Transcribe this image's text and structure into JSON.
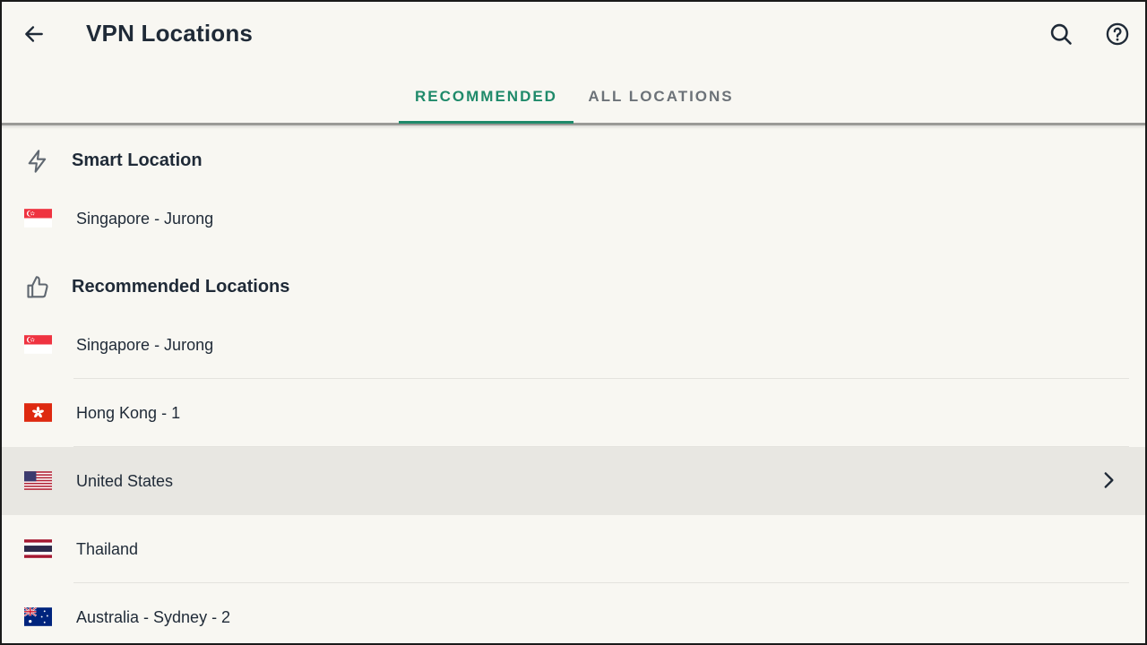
{
  "header": {
    "title": "VPN Locations",
    "back_icon": "arrow-left-icon",
    "search_icon": "search-icon",
    "help_icon": "help-circle-icon"
  },
  "tabs": [
    {
      "label": "RECOMMENDED",
      "active": true
    },
    {
      "label": "ALL LOCATIONS",
      "active": false
    }
  ],
  "colors": {
    "accent": "#1f8a6a",
    "background": "#f8f7f2",
    "selected_row": "#e8e7e2",
    "text": "#1f2a37",
    "inactive_tab": "#6c7278"
  },
  "smart_section": {
    "title": "Smart Location",
    "icon": "lightning-icon",
    "items": [
      {
        "label": "Singapore - Jurong",
        "flag": "singapore-flag-icon"
      }
    ]
  },
  "recommended_section": {
    "title": "Recommended Locations",
    "icon": "thumbs-up-icon",
    "items": [
      {
        "label": "Singapore - Jurong",
        "flag": "singapore-flag-icon"
      },
      {
        "label": "Hong Kong - 1",
        "flag": "hong-kong-flag-icon"
      },
      {
        "label": "United States",
        "flag": "united-states-flag-icon",
        "selected": true
      },
      {
        "label": "Thailand",
        "flag": "thailand-flag-icon"
      },
      {
        "label": "Australia - Sydney - 2",
        "flag": "australia-flag-icon"
      }
    ]
  }
}
